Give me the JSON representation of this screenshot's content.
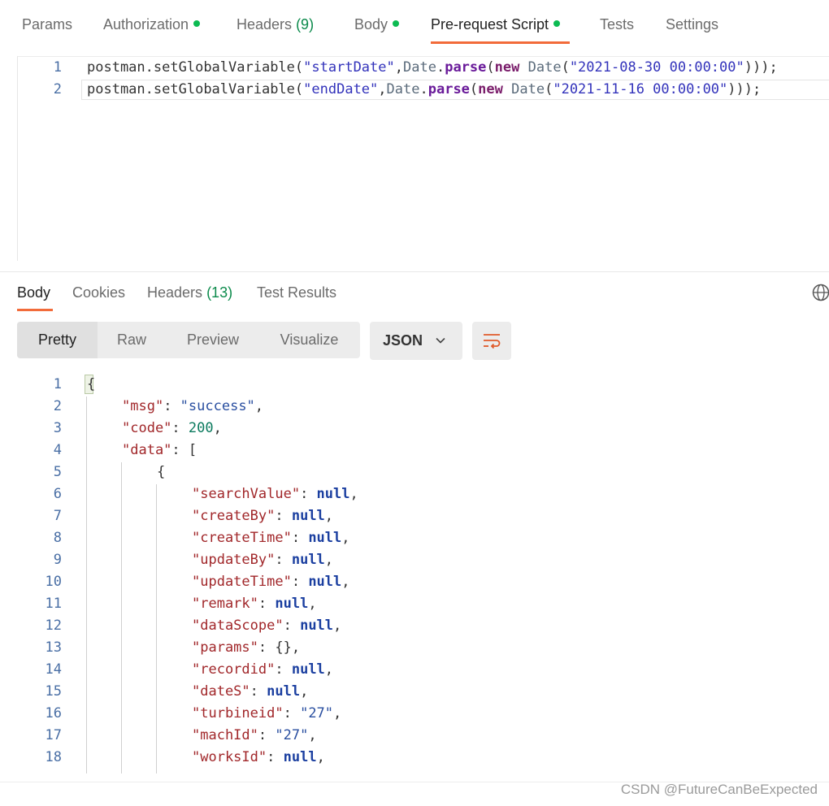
{
  "request_tabs": [
    {
      "label": "Params"
    },
    {
      "label": "Authorization"
    },
    {
      "label": "Headers",
      "count": "(9)"
    },
    {
      "label": "Body"
    },
    {
      "label": "Pre-request Script"
    },
    {
      "label": "Tests"
    },
    {
      "label": "Settings"
    }
  ],
  "script": {
    "lines": [
      {
        "num": "1",
        "obj": "postman",
        "dot": ".",
        "method": "setGlobalVariable",
        "open": "(",
        "key": "\"startDate\"",
        "comma": ",",
        "cls": "Date",
        "dot2": ".",
        "fn": "parse",
        "open2": "(",
        "kw": "new",
        "ctor": "Date",
        "open3": "(",
        "date": "\"2021-08-30 00:00:00\"",
        "close": ")));"
      },
      {
        "num": "2",
        "obj": "postman",
        "dot": ".",
        "method": "setGlobalVariable",
        "open": "(",
        "key": "\"endDate\"",
        "comma": ",",
        "cls": "Date",
        "dot2": ".",
        "fn": "parse",
        "open2": "(",
        "kw": "new",
        "ctor": "Date",
        "open3": "(",
        "date": "\"2021-11-16 00:00:00\"",
        "close": ")));"
      }
    ]
  },
  "response_tabs": [
    {
      "label": "Body"
    },
    {
      "label": "Cookies"
    },
    {
      "label": "Headers",
      "count": "(13)"
    },
    {
      "label": "Test Results"
    }
  ],
  "view_modes": [
    "Pretty",
    "Raw",
    "Preview",
    "Visualize"
  ],
  "format": "JSON",
  "json_lines": [
    {
      "num": "1",
      "parts": [
        [
          "p",
          "{"
        ]
      ]
    },
    {
      "num": "2",
      "parts": [
        [
          "k",
          "\"msg\""
        ],
        [
          "p",
          ": "
        ],
        [
          "s",
          "\"success\""
        ],
        [
          "p",
          ","
        ]
      ]
    },
    {
      "num": "3",
      "parts": [
        [
          "k",
          "\"code\""
        ],
        [
          "p",
          ": "
        ],
        [
          "n",
          "200"
        ],
        [
          "p",
          ","
        ]
      ]
    },
    {
      "num": "4",
      "parts": [
        [
          "k",
          "\"data\""
        ],
        [
          "p",
          ": ["
        ]
      ]
    },
    {
      "num": "5",
      "parts": [
        [
          "p",
          "{"
        ]
      ]
    },
    {
      "num": "6",
      "parts": [
        [
          "k",
          "\"searchValue\""
        ],
        [
          "p",
          ": "
        ],
        [
          "nl",
          "null"
        ],
        [
          "p",
          ","
        ]
      ]
    },
    {
      "num": "7",
      "parts": [
        [
          "k",
          "\"createBy\""
        ],
        [
          "p",
          ": "
        ],
        [
          "nl",
          "null"
        ],
        [
          "p",
          ","
        ]
      ]
    },
    {
      "num": "8",
      "parts": [
        [
          "k",
          "\"createTime\""
        ],
        [
          "p",
          ": "
        ],
        [
          "nl",
          "null"
        ],
        [
          "p",
          ","
        ]
      ]
    },
    {
      "num": "9",
      "parts": [
        [
          "k",
          "\"updateBy\""
        ],
        [
          "p",
          ": "
        ],
        [
          "nl",
          "null"
        ],
        [
          "p",
          ","
        ]
      ]
    },
    {
      "num": "10",
      "parts": [
        [
          "k",
          "\"updateTime\""
        ],
        [
          "p",
          ": "
        ],
        [
          "nl",
          "null"
        ],
        [
          "p",
          ","
        ]
      ]
    },
    {
      "num": "11",
      "parts": [
        [
          "k",
          "\"remark\""
        ],
        [
          "p",
          ": "
        ],
        [
          "nl",
          "null"
        ],
        [
          "p",
          ","
        ]
      ]
    },
    {
      "num": "12",
      "parts": [
        [
          "k",
          "\"dataScope\""
        ],
        [
          "p",
          ": "
        ],
        [
          "nl",
          "null"
        ],
        [
          "p",
          ","
        ]
      ]
    },
    {
      "num": "13",
      "parts": [
        [
          "k",
          "\"params\""
        ],
        [
          "p",
          ": {},"
        ]
      ]
    },
    {
      "num": "14",
      "parts": [
        [
          "k",
          "\"recordid\""
        ],
        [
          "p",
          ": "
        ],
        [
          "nl",
          "null"
        ],
        [
          "p",
          ","
        ]
      ]
    },
    {
      "num": "15",
      "parts": [
        [
          "k",
          "\"dateS\""
        ],
        [
          "p",
          ": "
        ],
        [
          "nl",
          "null"
        ],
        [
          "p",
          ","
        ]
      ]
    },
    {
      "num": "16",
      "parts": [
        [
          "k",
          "\"turbineid\""
        ],
        [
          "p",
          ": "
        ],
        [
          "s",
          "\"27\""
        ],
        [
          "p",
          ","
        ]
      ]
    },
    {
      "num": "17",
      "parts": [
        [
          "k",
          "\"machId\""
        ],
        [
          "p",
          ": "
        ],
        [
          "s",
          "\"27\""
        ],
        [
          "p",
          ","
        ]
      ]
    },
    {
      "num": "18",
      "parts": [
        [
          "k",
          "\"worksId\""
        ],
        [
          "p",
          ": "
        ],
        [
          "nl",
          "null"
        ],
        [
          "p",
          ","
        ]
      ]
    }
  ],
  "watermark": "CSDN @FutureCanBeExpected",
  "colors": {
    "accent": "#f26b3a",
    "status_dot": "#0cbb52"
  }
}
